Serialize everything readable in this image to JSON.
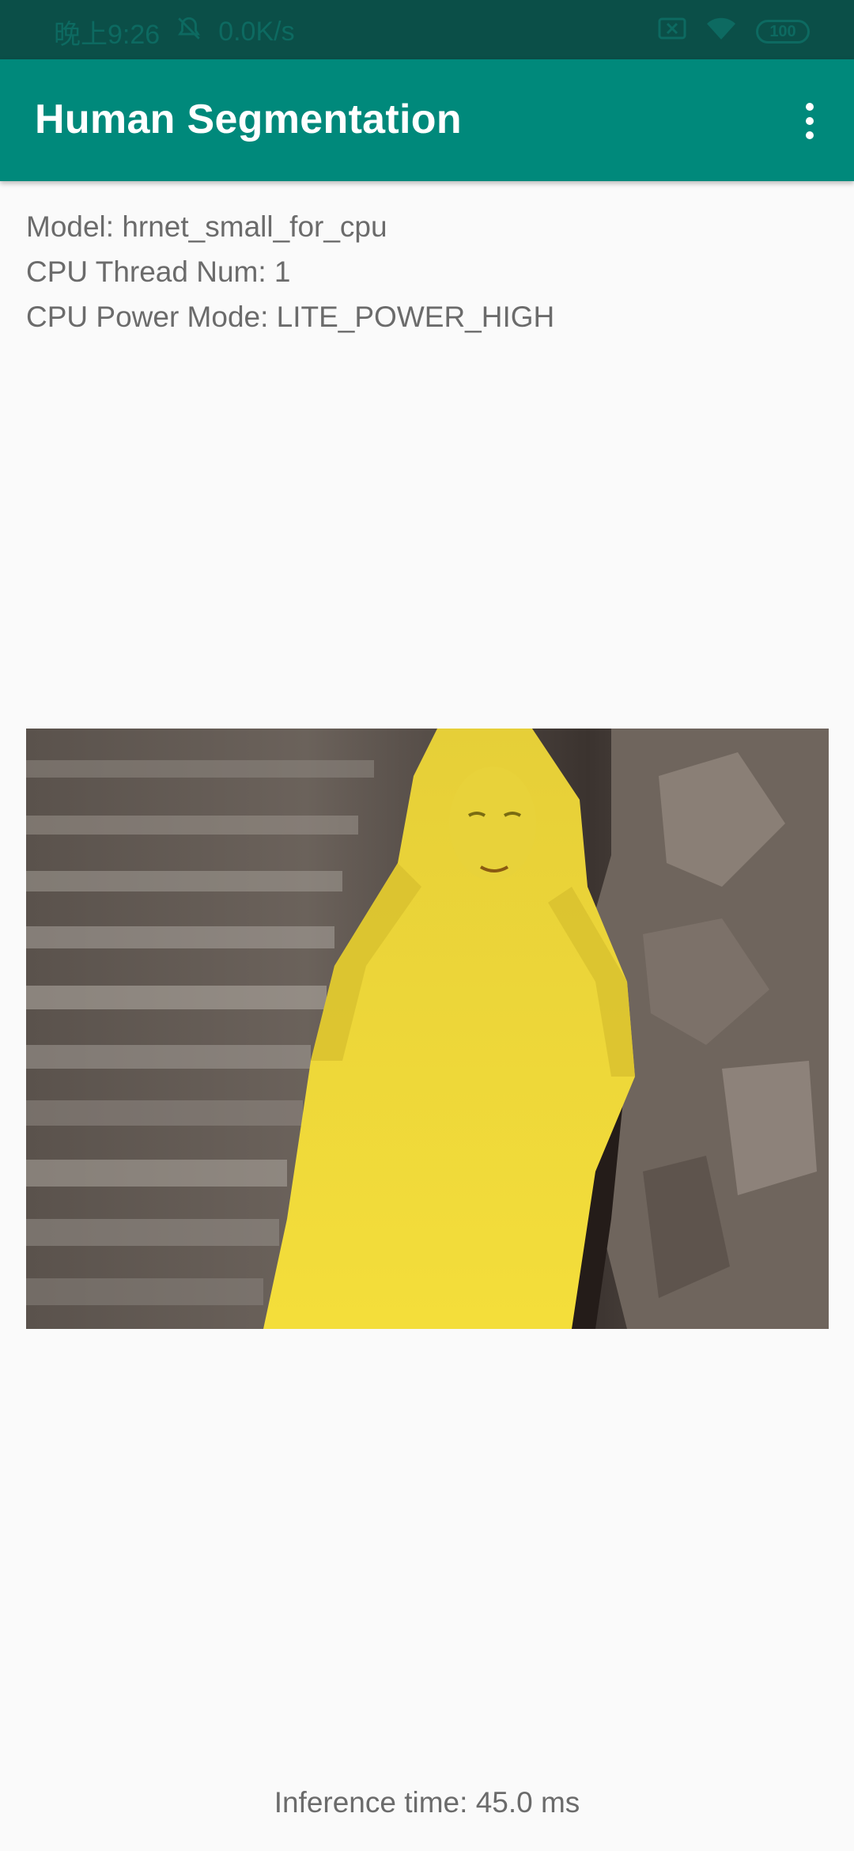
{
  "status_bar": {
    "time": "晚上9:26",
    "net_speed": "0.0K/s",
    "battery": "100",
    "icons": [
      "alarm-off-icon",
      "sim-blocked-icon",
      "wifi-icon",
      "battery-icon"
    ]
  },
  "app_bar": {
    "title": "Human Segmentation",
    "menu_icon": "more-vert-icon"
  },
  "info": {
    "model": "Model: hrnet_small_for_cpu",
    "threads": "CPU Thread Num: 1",
    "power_mode": "CPU Power Mode: LITE_POWER_HIGH"
  },
  "result": {
    "inference_time": "Inference time: 45.0 ms"
  },
  "colors": {
    "status_bar": "#0b4f48",
    "app_bar": "#00897b",
    "mask": "#f2d92f"
  }
}
